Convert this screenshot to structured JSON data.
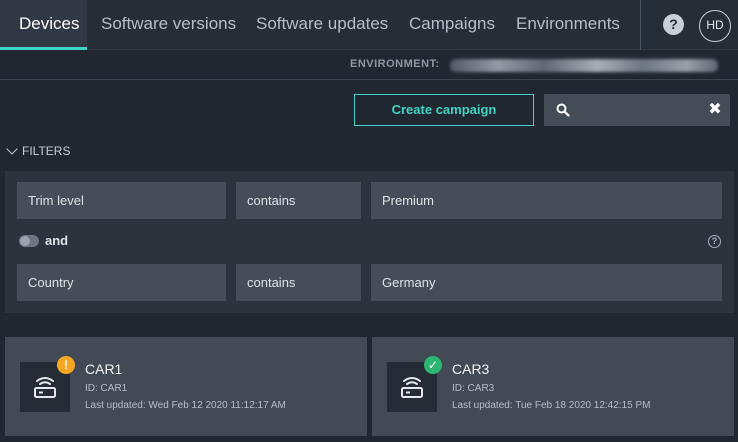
{
  "nav": {
    "tabs": [
      {
        "label": "Devices",
        "active": true
      },
      {
        "label": "Software versions",
        "active": false
      },
      {
        "label": "Software updates",
        "active": false
      },
      {
        "label": "Campaigns",
        "active": false
      },
      {
        "label": "Environments",
        "active": false
      }
    ],
    "help_label": "?",
    "avatar_initials": "HD"
  },
  "environment": {
    "label": "ENVIRONMENT:",
    "value_obscured": true
  },
  "toolbar": {
    "create_campaign_label": "Create campaign",
    "search": {
      "value": "",
      "placeholder": "",
      "icon": "search-icon",
      "clear_icon": "close-icon"
    }
  },
  "filters": {
    "toggle_label": "FILTERS",
    "expanded": true,
    "rows": [
      {
        "field": "Trim level",
        "operator": "contains",
        "value": "Premium"
      },
      {
        "field": "Country",
        "operator": "contains",
        "value": "Germany"
      }
    ],
    "combinator": "and",
    "help_label": "?"
  },
  "devices": [
    {
      "name": "CAR1",
      "id": "ID: CAR1",
      "last_updated": "Last updated: Wed Feb 12 2020 11:12:17 AM",
      "status": "warning",
      "status_glyph": "!"
    },
    {
      "name": "CAR3",
      "id": "ID: CAR3",
      "last_updated": "Last updated: Tue Feb 18 2020 12:42:15 PM",
      "status": "ok",
      "status_glyph": "✓"
    }
  ],
  "colors": {
    "accent": "#3fd4c6",
    "background": "#202730",
    "warning": "#f5a623",
    "success": "#2bb673"
  }
}
